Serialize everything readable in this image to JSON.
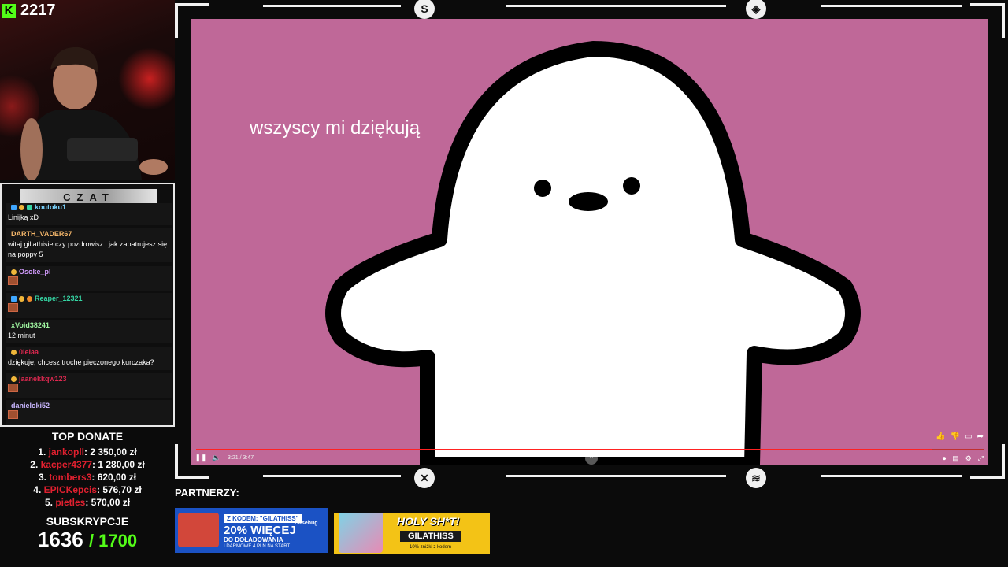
{
  "viewers": {
    "icon": "K",
    "count": "2217"
  },
  "chat": {
    "title": "CZAT",
    "messages": [
      {
        "user": "koutoku1",
        "color": "#7bd4ff",
        "text": "Linijką xD"
      },
      {
        "user": "DARTH_VADER67",
        "color": "#f4b66a",
        "text": "witaj gillathisie czy pozdrowisz i jak zapatrujesz się na poppy 5"
      },
      {
        "user": "Osoke_pl",
        "color": "#d39cff",
        "text": ""
      },
      {
        "user": "Reaper_12321",
        "color": "#35d6a4",
        "text": ""
      },
      {
        "user": "xVoid38241",
        "color": "#9ff5a0",
        "text": "12 minut"
      },
      {
        "user": "0leiaa",
        "color": "#e02850",
        "text": "dziękuje, chcesz troche pieczonego kurczaka?"
      },
      {
        "user": "jaanekkqw123",
        "color": "#e02850",
        "text": ""
      },
      {
        "user": "danieloki52",
        "color": "#c9b7ff",
        "text": ""
      }
    ]
  },
  "donate": {
    "title": "TOP DONATE",
    "entries": [
      {
        "rank": "1.",
        "name": "jankopll",
        "amount": ": 2 350,00 zł"
      },
      {
        "rank": "2.",
        "name": "kacper4377",
        "amount": ": 1 280,00 zł"
      },
      {
        "rank": "3.",
        "name": "tombers3",
        "amount": ": 620,00 zł"
      },
      {
        "rank": "4.",
        "name": "EPICKepcis",
        "amount": ": 576,70 zł"
      },
      {
        "rank": "5.",
        "name": "pietles",
        "amount": ": 570,00 zł"
      }
    ],
    "subs_title": "SUBSKRYPCJE",
    "subs_count": "1636",
    "subs_goal": "/ 1700"
  },
  "video": {
    "caption": "wszyscy mi dziękują",
    "time": "3:21 / 3:47",
    "progress": 0.934,
    "background": "#bf6898"
  },
  "partners": {
    "label": "PARTNERZY:",
    "banner1": {
      "code": "Z KODEM: \"GILATHISS\"",
      "headline": "20% WIĘCEJ",
      "sub": "DO DOŁADOWANIA",
      "small": "I DARMOWE 4 PLN NA START",
      "brand": "Casehug"
    },
    "banner2": {
      "headline": "HOLY SH*T!",
      "code": "GILATHISS",
      "small": "10% zniżki z kodem"
    }
  }
}
